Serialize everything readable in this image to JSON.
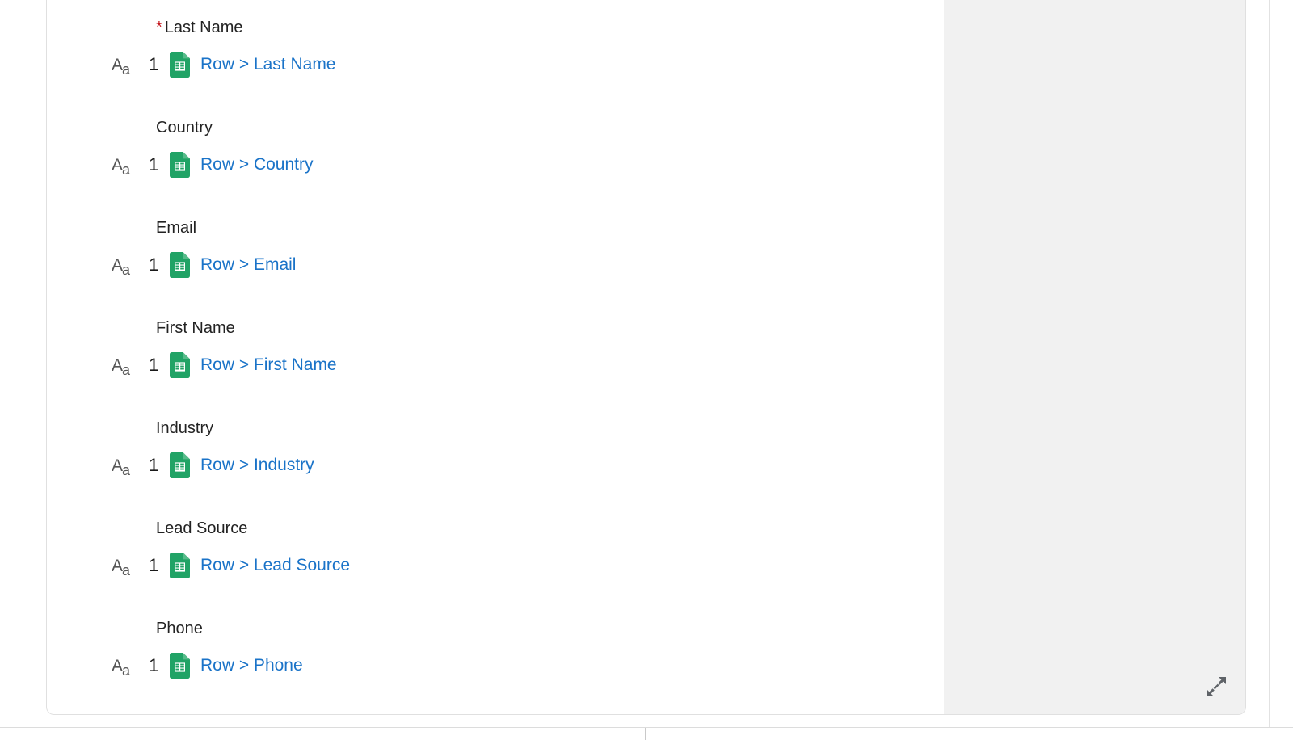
{
  "card": {
    "fields": [
      {
        "label": "Last Name",
        "required": true,
        "type_icon": "text-type-icon",
        "type_icon_label": "Aa",
        "step": "1",
        "source_icon": "google-sheets-icon",
        "mapping": "Row > Last Name"
      },
      {
        "label": "Country",
        "required": false,
        "type_icon": "text-type-icon",
        "type_icon_label": "Aa",
        "step": "1",
        "source_icon": "google-sheets-icon",
        "mapping": "Row > Country"
      },
      {
        "label": "Email",
        "required": false,
        "type_icon": "text-type-icon",
        "type_icon_label": "Aa",
        "step": "1",
        "source_icon": "google-sheets-icon",
        "mapping": "Row > Email"
      },
      {
        "label": "First Name",
        "required": false,
        "type_icon": "text-type-icon",
        "type_icon_label": "Aa",
        "step": "1",
        "source_icon": "google-sheets-icon",
        "mapping": "Row > First Name"
      },
      {
        "label": "Industry",
        "required": false,
        "type_icon": "text-type-icon",
        "type_icon_label": "Aa",
        "step": "1",
        "source_icon": "google-sheets-icon",
        "mapping": "Row > Industry"
      },
      {
        "label": "Lead Source",
        "required": false,
        "type_icon": "text-type-icon",
        "type_icon_label": "Aa",
        "step": "1",
        "source_icon": "google-sheets-icon",
        "mapping": "Row > Lead Source"
      },
      {
        "label": "Phone",
        "required": false,
        "type_icon": "text-type-icon",
        "type_icon_label": "Aa",
        "step": "1",
        "source_icon": "google-sheets-icon",
        "mapping": "Row > Phone"
      }
    ],
    "required_marker": "*"
  },
  "preview": {
    "expand_icon": "expand-diagonal-icon"
  },
  "colors": {
    "link": "#1a73c8",
    "required": "#c4161c",
    "sheets_green": "#21a366",
    "sheets_fold": "#57bb8a",
    "panel_bg": "#f1f1f1",
    "label_text": "#222222",
    "icon_gray": "#555555",
    "border": "#e0e0e0"
  }
}
